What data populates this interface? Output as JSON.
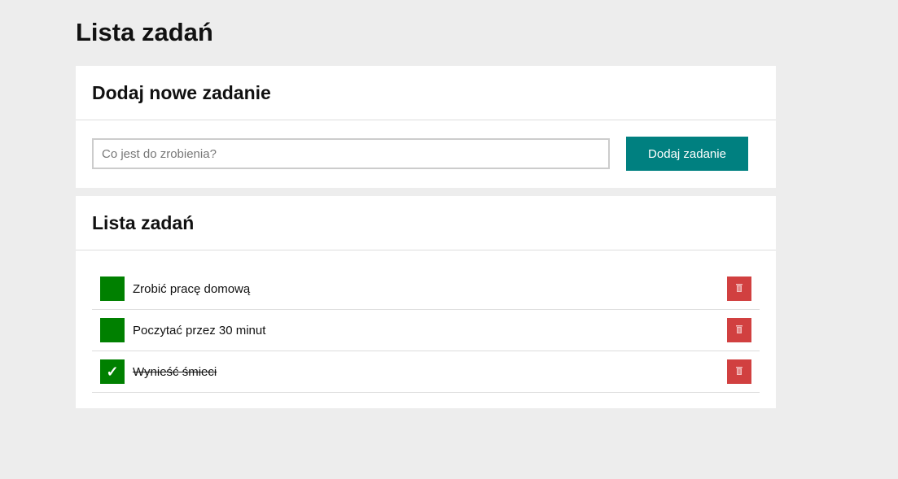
{
  "page": {
    "title": "Lista zadań"
  },
  "add_card": {
    "title": "Dodaj nowe zadanie",
    "input_value": "",
    "placeholder": "Co jest do zrobienia?",
    "button_label": "Dodaj zadanie"
  },
  "list_card": {
    "title": "Lista zadań"
  },
  "tasks": [
    {
      "label": "Zrobić pracę domową",
      "done": false
    },
    {
      "label": "Poczytać przez 30 minut",
      "done": false
    },
    {
      "label": "Wynieść śmieci",
      "done": true
    }
  ],
  "icons": {
    "check": "✓",
    "delete": "trash-icon"
  },
  "colors": {
    "accent": "#008080",
    "check": "#008000",
    "delete": "#d14040"
  }
}
